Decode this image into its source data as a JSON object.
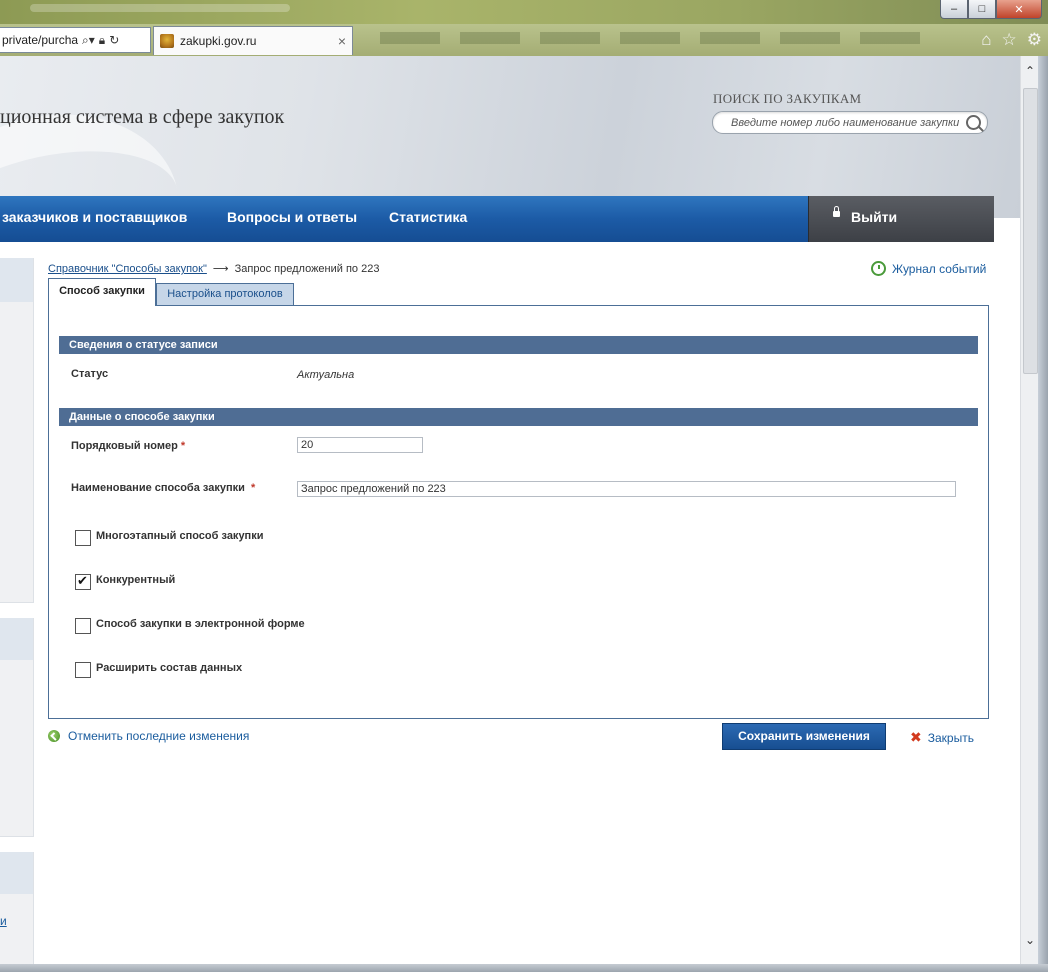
{
  "browser": {
    "address_url": "private/purcha",
    "tab_title": "zakupki.gov.ru",
    "tab_close": "×",
    "window_min": "‒",
    "window_max": "□",
    "window_close": "✕"
  },
  "header": {
    "site_title": "ционная система в сфере закупок",
    "search_label": "ПОИСК ПО ЗАКУПКАМ",
    "search_placeholder": "Введите номер либо наименование закупки"
  },
  "nav": {
    "items": [
      "заказчиков и поставщиков",
      "Вопросы и ответы",
      "Статистика"
    ],
    "logout_label": "Выйти"
  },
  "breadcrumb": {
    "link": "Справочник \"Способы закупок\"",
    "arrow": "⟶",
    "current": "Запрос предложений по 223"
  },
  "journal_label": "Журнал событий",
  "tabs": [
    {
      "label": "Способ закупки",
      "active": true
    },
    {
      "label": "Настройка протоколов",
      "active": false
    }
  ],
  "sections": {
    "status": {
      "title": "Сведения о статусе записи",
      "status_label": "Статус",
      "status_value": "Актуальна"
    },
    "method": {
      "title": "Данные о способе закупки",
      "number_label": "Порядковый номер",
      "number_value": "20",
      "name_label": "Наименование способа закупки",
      "name_value": "Запрос предложений по 223",
      "required_mark": "*"
    }
  },
  "checkboxes": [
    {
      "label": "Многоэтапный способ закупки",
      "checked": false
    },
    {
      "label": "Конкурентный",
      "checked": true
    },
    {
      "label": "Способ закупки в электронной форме",
      "checked": false
    },
    {
      "label": "Расширить состав данных",
      "checked": false
    }
  ],
  "footer": {
    "undo_label": "Отменить последние изменения",
    "save_label": "Сохранить изменения",
    "close_label": "Закрыть"
  },
  "sidebar_link": "и",
  "colors": {
    "nav_blue": "#1c5ba6",
    "section_header": "#4f6d94",
    "link": "#1a5c9e",
    "required": "#c0392b"
  }
}
